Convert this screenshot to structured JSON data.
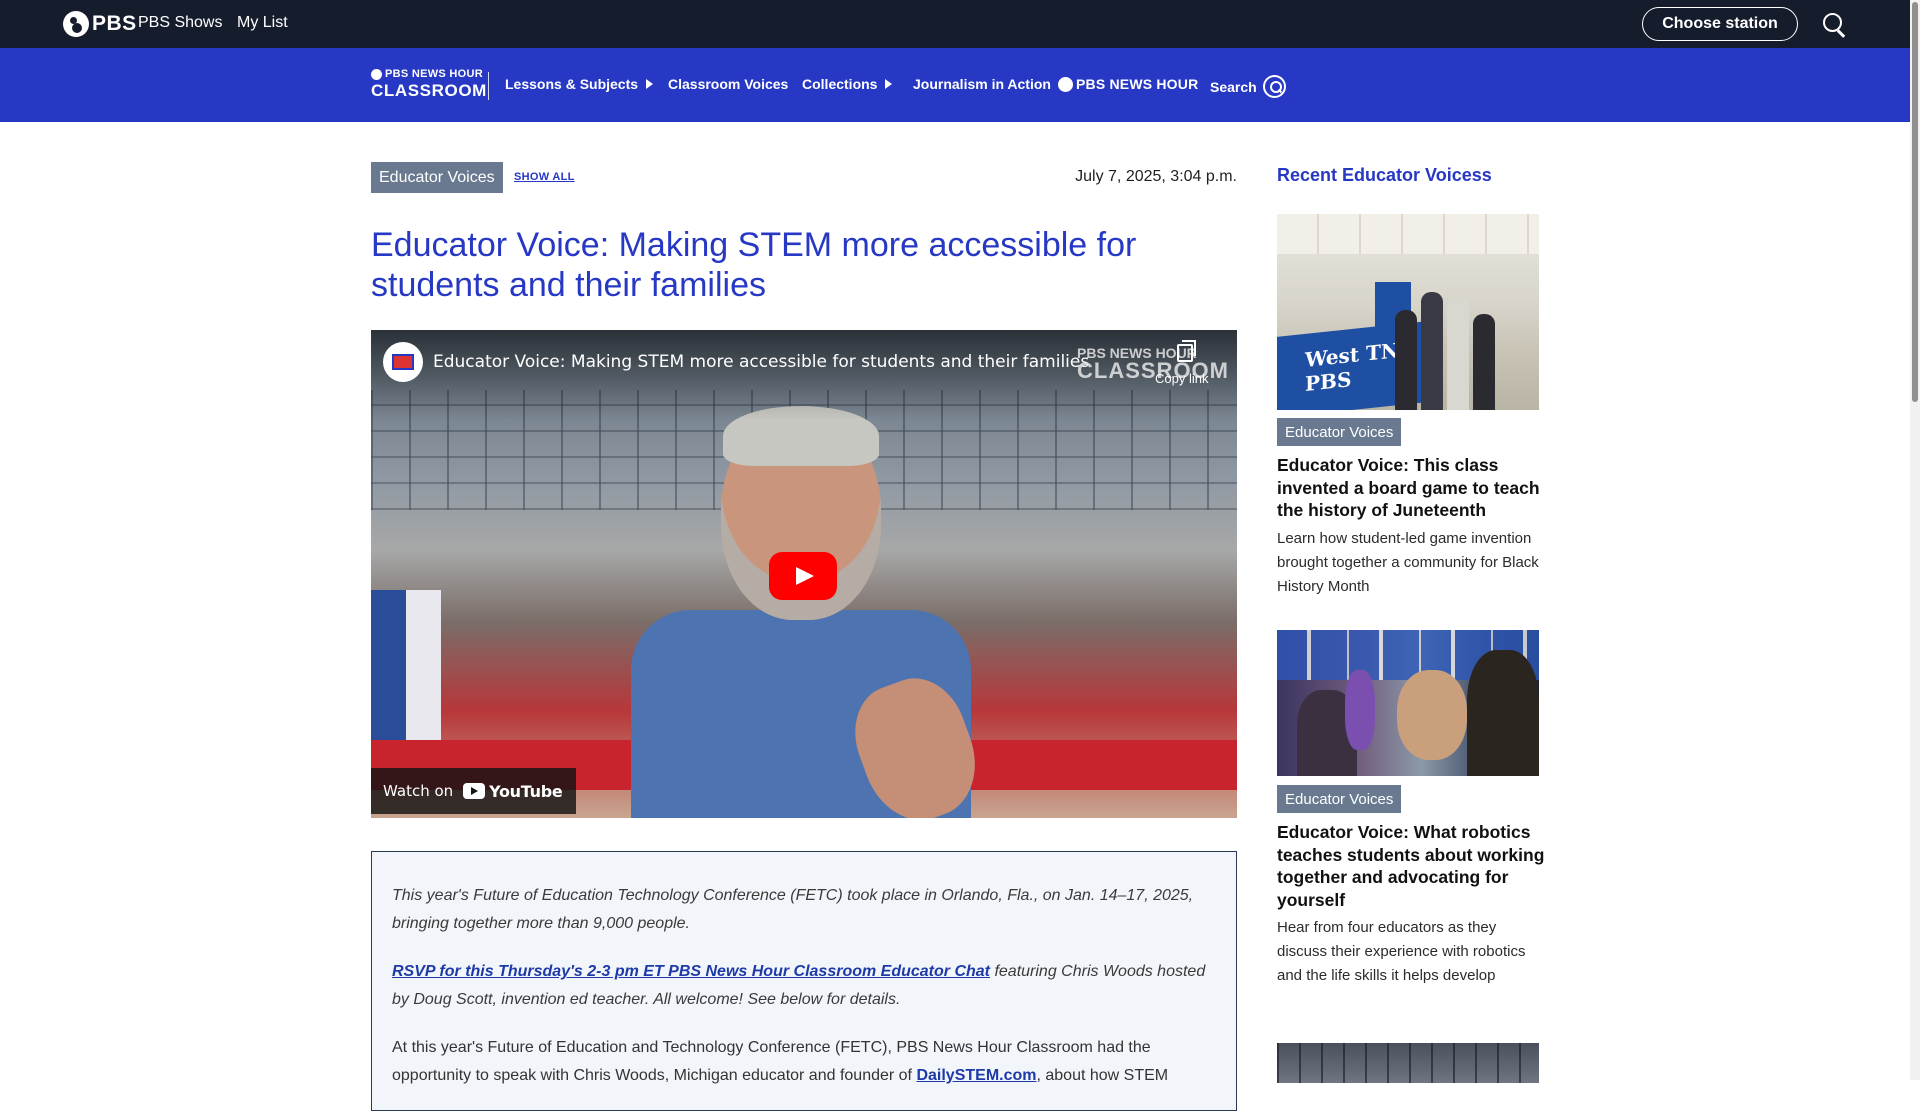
{
  "topbar": {
    "brand": "PBS",
    "links": [
      "PBS Shows",
      "My List"
    ],
    "choose_station": "Choose station"
  },
  "nav": {
    "logo_line1": "PBS NEWS HOUR",
    "logo_line2": "CLASSROOM",
    "items": [
      {
        "label": "Lessons & Subjects"
      },
      {
        "label": "Classroom Voices"
      },
      {
        "label": "Collections"
      },
      {
        "label": "Journalism in Action"
      }
    ],
    "newshour_logo": "PBS NEWS HOUR",
    "search_label": "Search"
  },
  "article": {
    "category": "Educator Voices",
    "show_all": "SHOW ALL",
    "date": "July 7, 2025, 3:04 p.m.",
    "headline": "Educator Voice: Making STEM more accessible for students and their families",
    "video": {
      "title": "Educator Voice: Making STEM more accessible for students and their families",
      "watermark_line1": "PBS NEWS HOUR",
      "watermark_line2": "CLASSROOM",
      "copy_link": "Copy link",
      "watch_on": "Watch on",
      "youtube": "YouTube"
    },
    "intro_p1": "This year's Future of Education Technology Conference (FETC) took place in Orlando, Fla., on Jan. 14–17, 2025, bringing together more than 9,000 people.",
    "rsvp_link": "RSVP for this Thursday's 2-3 pm ET PBS News Hour Classroom Educator Chat",
    "rsvp_rest": " featuring Chris Woods hosted by Doug Scott, invention ed teacher. All welcome! See below for details.",
    "body_p_start": "At this year's Future of Education and Technology Conference (FETC), PBS News Hour Classroom had the opportunity to speak with Chris Woods, Michigan educator and founder of ",
    "body_link": "DailySTEM.com",
    "body_p_end": ", about how STEM"
  },
  "sidebar": {
    "heading": "Recent Educator Voicess",
    "cards": [
      {
        "tag": "Educator Voices",
        "title": "Educator Voice: This class invented a board game to teach the history of Juneteenth",
        "desc": "Learn how student-led game invention brought together a community for Black History Month",
        "image_text": "West TN PBS"
      },
      {
        "tag": "Educator Voices",
        "title": "Educator Voice: What robotics teaches students about working together and advocating for yourself",
        "desc": "Hear from four educators as they discuss their experience with robotics and the life skills it helps develop"
      }
    ]
  },
  "colors": {
    "topbar_bg": "#151c2c",
    "nav_bg": "#2638c4",
    "headline": "#2638c4",
    "tag_bg": "#697a90",
    "article_box_bg": "#f2f6fa"
  }
}
